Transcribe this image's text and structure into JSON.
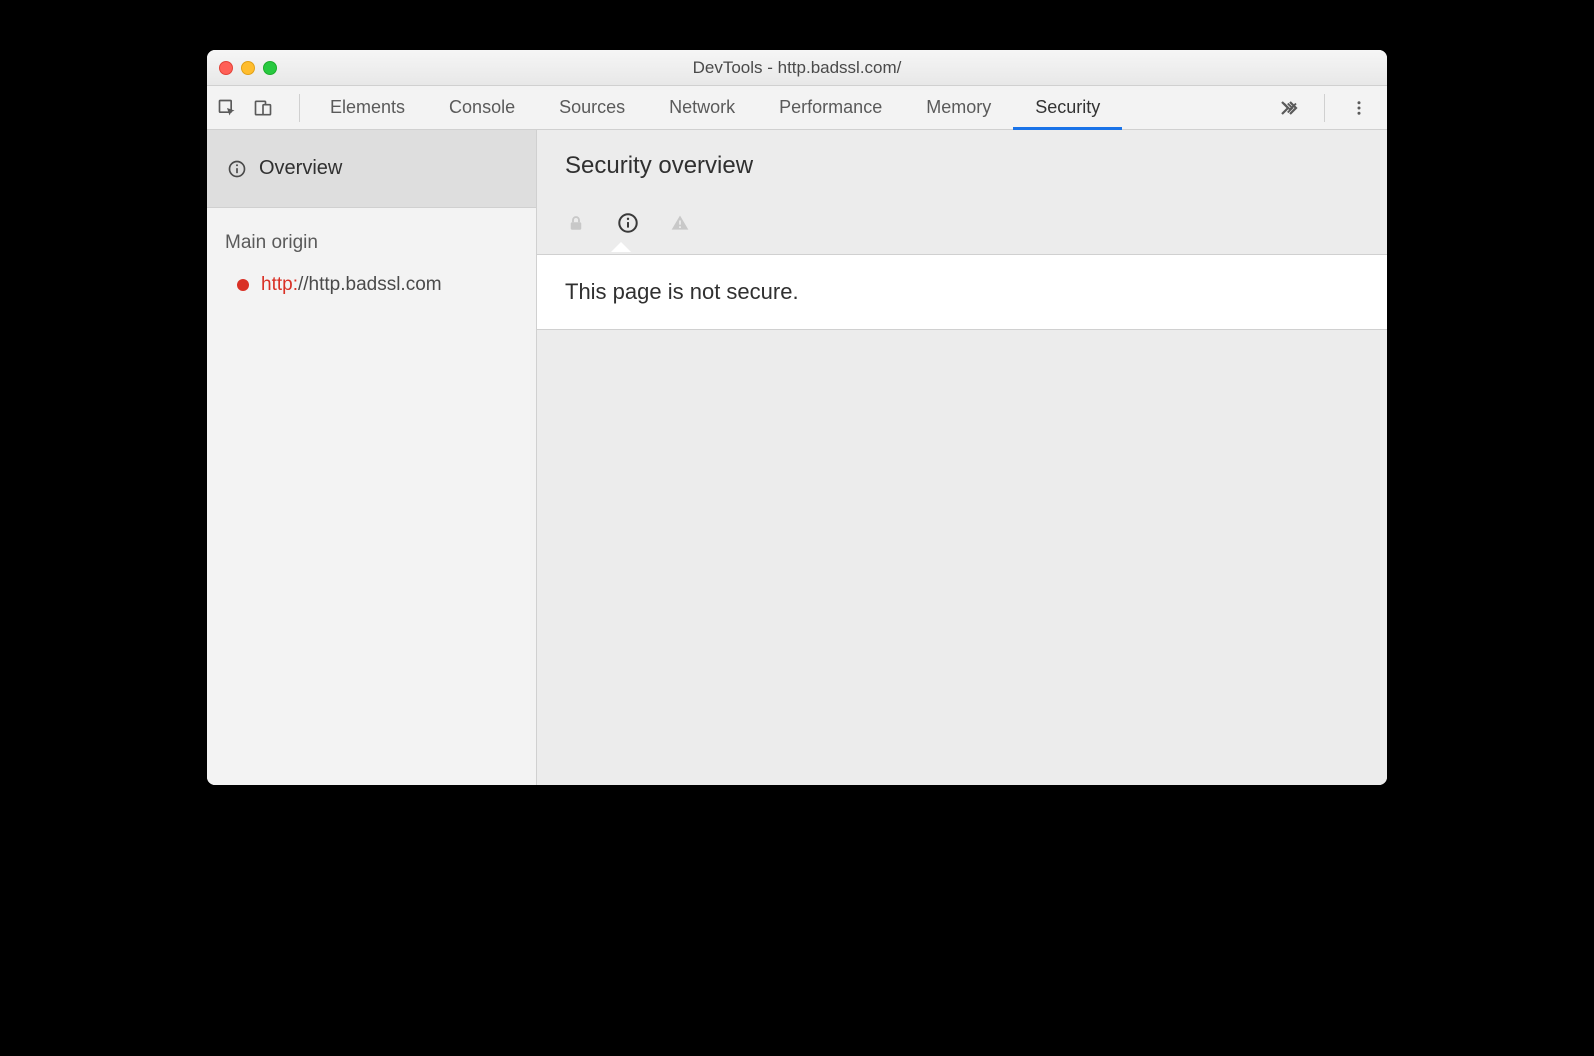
{
  "window": {
    "title": "DevTools - http.badssl.com/"
  },
  "tabs": {
    "items": [
      "Elements",
      "Console",
      "Sources",
      "Network",
      "Performance",
      "Memory",
      "Security"
    ],
    "active": "Security"
  },
  "sidebar": {
    "overview_label": "Overview",
    "section_label": "Main origin",
    "origin": {
      "scheme": "http:",
      "rest": "//http.badssl.com",
      "status_color": "#d93025"
    }
  },
  "main": {
    "heading": "Security overview",
    "message": "This page is not secure.",
    "security_state": "info"
  }
}
